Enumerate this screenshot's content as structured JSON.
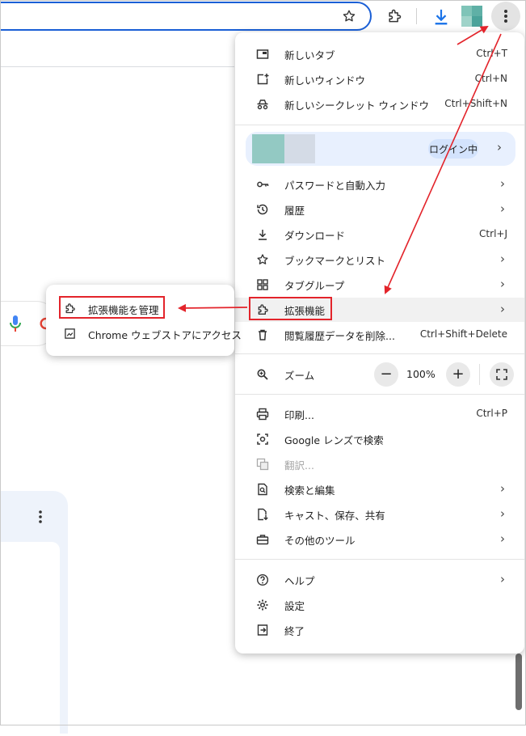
{
  "colors": {
    "accent": "#1a5fd6",
    "annotation": "#e3242b",
    "profile_bg": "#e8f0fe",
    "hover_bg": "#f1f1f1"
  },
  "toolbar": {
    "icons": [
      "star-icon",
      "extensions-icon",
      "download-icon",
      "profile-avatar",
      "more-vert-icon"
    ]
  },
  "menu": {
    "new_tab": {
      "label": "新しいタブ",
      "shortcut": "Ctrl+T"
    },
    "new_window": {
      "label": "新しいウィンドウ",
      "shortcut": "Ctrl+N"
    },
    "new_incognito": {
      "label": "新しいシークレット ウィンドウ",
      "shortcut": "Ctrl+Shift+N"
    },
    "profile": {
      "status": "ログイン中"
    },
    "passwords": {
      "label": "パスワードと自動入力"
    },
    "history": {
      "label": "履歴"
    },
    "downloads": {
      "label": "ダウンロード",
      "shortcut": "Ctrl+J"
    },
    "bookmarks": {
      "label": "ブックマークとリスト"
    },
    "tab_groups": {
      "label": "タブグループ"
    },
    "extensions": {
      "label": "拡張機能"
    },
    "clear_data": {
      "label": "閲覧履歴データを削除...",
      "shortcut": "Ctrl+Shift+Delete"
    },
    "zoom": {
      "label": "ズーム",
      "minus": "−",
      "value": "100%",
      "plus": "+"
    },
    "print": {
      "label": "印刷...",
      "shortcut": "Ctrl+P"
    },
    "lens": {
      "label": "Google レンズで検索"
    },
    "translate": {
      "label": "翻訳..."
    },
    "find_edit": {
      "label": "検索と編集"
    },
    "cast": {
      "label": "キャスト、保存、共有"
    },
    "more_tools": {
      "label": "その他のツール"
    },
    "help": {
      "label": "ヘルプ"
    },
    "settings": {
      "label": "設定"
    },
    "exit": {
      "label": "終了"
    }
  },
  "submenu": {
    "manage": {
      "label": "拡張機能を管理"
    },
    "webstore": {
      "label": "Chrome ウェブストアにアクセス"
    }
  },
  "chevron": "›"
}
